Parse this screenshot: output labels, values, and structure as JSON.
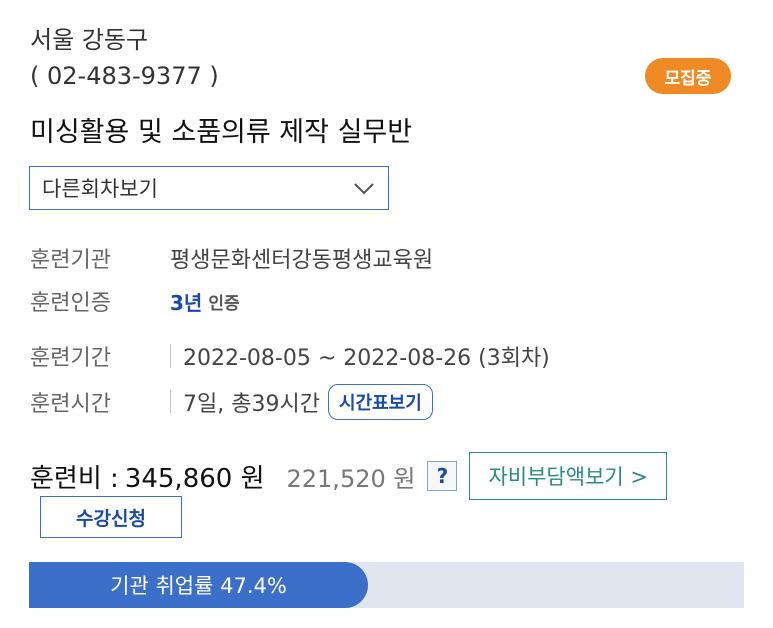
{
  "header": {
    "location": "서울 강동구",
    "phone": "( 02-483-9377 )",
    "status_badge": "모집중",
    "course_title": "미싱활용 및 소품의류 제작 실무반"
  },
  "session_select": {
    "selected": "다른회차보기"
  },
  "details": {
    "institution_label": "훈련기관",
    "institution_value": "평생문화센터강동평생교육원",
    "certification_label": "훈련인증",
    "certification_value": "3년",
    "certification_suffix": "인증",
    "period_label": "훈련기간",
    "period_value": "2022-08-05 ~ 2022-08-26 (3회차)",
    "hours_label": "훈련시간",
    "hours_value": "7일, 총39시간",
    "timetable_button": "시간표보기"
  },
  "fee": {
    "label": "훈련비 :",
    "amount": "345,860 원",
    "self_pay": "221,520 원",
    "help_button": "?",
    "self_pay_button": "자비부담액보기 >"
  },
  "enroll_button": "수강신청",
  "employment": {
    "text": "기관 취업률 47.4%",
    "rate_percent": 47.4
  },
  "colors": {
    "accent": "#3b6fc9",
    "badge": "#f08a24",
    "teal": "#2a8c7e"
  },
  "icons": {
    "select_arrow": "chevron-down-icon"
  }
}
